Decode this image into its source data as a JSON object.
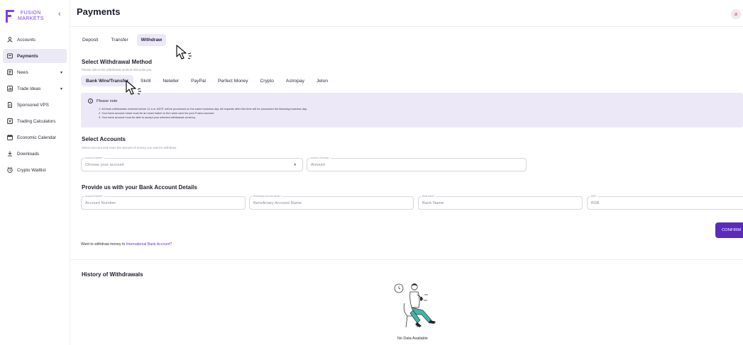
{
  "brand": {
    "line1": "FUSION",
    "line2": "MARKETS",
    "color": "#7b3fe4"
  },
  "sidebar": {
    "collapse_icon": "chevron-left-icon",
    "items": [
      {
        "label": "Accounts",
        "icon": "user-icon",
        "active": false,
        "expandable": false
      },
      {
        "label": "Payments",
        "icon": "card-icon",
        "active": true,
        "expandable": false
      },
      {
        "label": "News",
        "icon": "news-icon",
        "active": false,
        "expandable": true
      },
      {
        "label": "Trade Ideas",
        "icon": "chart-icon",
        "active": false,
        "expandable": true
      },
      {
        "label": "Sponsored VPS",
        "icon": "document-icon",
        "active": false,
        "expandable": false
      },
      {
        "label": "Trading Calculators",
        "icon": "calculator-icon",
        "active": false,
        "expandable": false
      },
      {
        "label": "Economic Calendar",
        "icon": "calendar-icon",
        "active": false,
        "expandable": false
      },
      {
        "label": "Downloads",
        "icon": "download-icon",
        "active": false,
        "expandable": false
      },
      {
        "label": "Crypto Waitlist",
        "icon": "clock-icon",
        "active": false,
        "expandable": false
      }
    ]
  },
  "header": {
    "title": "Payments",
    "avatar_initial": "a"
  },
  "tabs": [
    {
      "label": "Deposit",
      "active": false
    },
    {
      "label": "Transfer",
      "active": false
    },
    {
      "label": "Withdraw",
      "active": true
    }
  ],
  "withdrawal_method": {
    "title": "Select Withdrawal Method",
    "subtitle": "Please select the withdrawal method that suits you.",
    "methods": [
      {
        "label": "Bank Wire/Transfer",
        "active": true
      },
      {
        "label": "Skrill",
        "active": false
      },
      {
        "label": "Neteller",
        "active": false
      },
      {
        "label": "PayPal",
        "active": false
      },
      {
        "label": "Perfect Money",
        "active": false
      },
      {
        "label": "Crypto",
        "active": false
      },
      {
        "label": "Astropay",
        "active": false
      },
      {
        "label": "Jeton",
        "active": false
      }
    ]
  },
  "note": {
    "title": "Please note",
    "lines": [
      "1. All bank withdrawals received before 11 a.m. AEST will be processed on the same business day. All requests after this time will be processed the following business day.",
      "2. Your bank account name must be an exact match to the name used for your Fusion account.",
      "3. Your bank account must be able to accept your selected withdrawal currency."
    ]
  },
  "accounts": {
    "title": "Select Accounts",
    "subtitle": "Select account and enter the amount of money you want to withdraw",
    "account_field": {
      "label": "Account Number *",
      "placeholder": "Choose your account"
    },
    "amount_field": {
      "label": "Amount of Money *",
      "placeholder": "Amount"
    }
  },
  "bank_details": {
    "title": "Provide us with your Bank Account Details",
    "fields": [
      {
        "label": "Account Number *",
        "placeholder": "Account Number"
      },
      {
        "label": "Beneficiary Account Name *",
        "placeholder": "Beneficiary Account Name"
      },
      {
        "label": "Bank Name *",
        "placeholder": "Bank Name"
      },
      {
        "label": "BSB *",
        "placeholder": "BSB"
      }
    ]
  },
  "confirm_label": "CONFIRM",
  "international": {
    "text": "Want to withdraw money to ",
    "link": "International Bank Account?"
  },
  "history": {
    "title": "History of Withdrawals",
    "empty": "No Data Available"
  },
  "accent_color": "#5b2bbd",
  "highlight_color": "#ece9f6"
}
